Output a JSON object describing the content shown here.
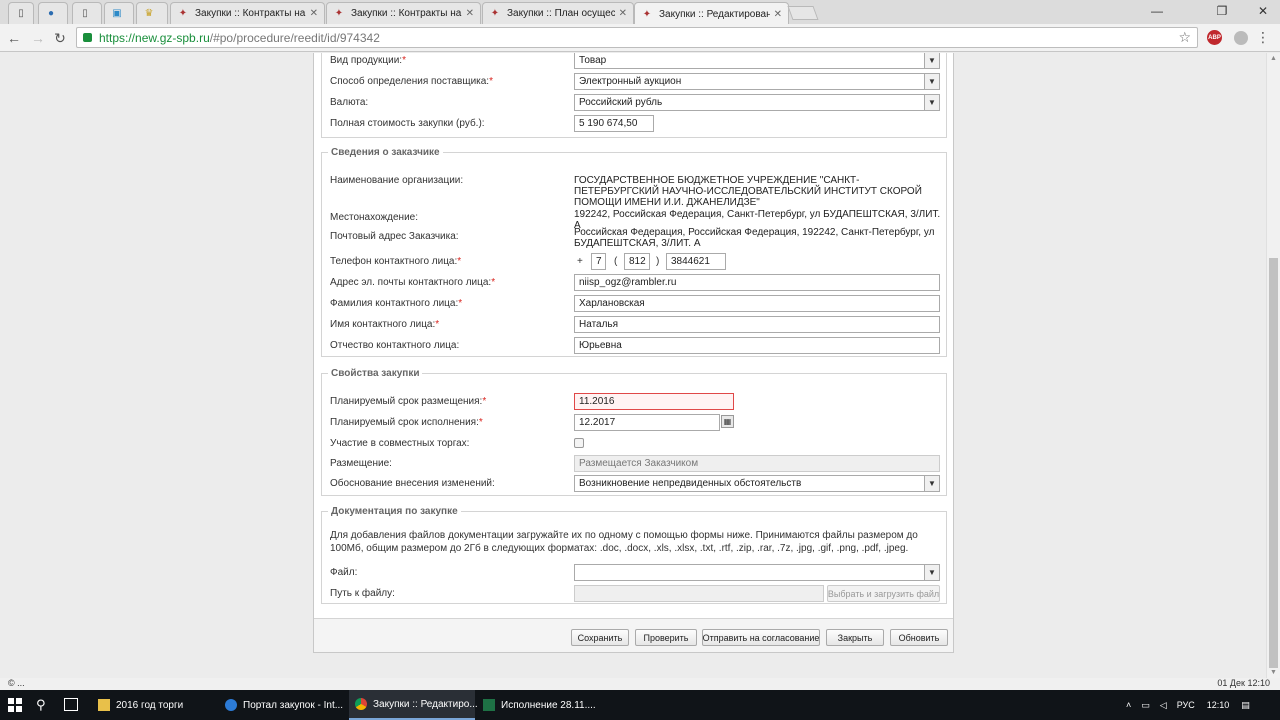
{
  "browser": {
    "tabs": [
      {
        "label": "",
        "active": false
      },
      {
        "label": "",
        "active": false
      },
      {
        "label": "",
        "active": false
      },
      {
        "label": "",
        "active": false
      },
      {
        "label": "",
        "active": false
      },
      {
        "label": "Закупки :: Контракты на",
        "active": false
      },
      {
        "label": "Закупки :: Контракты на",
        "active": false
      },
      {
        "label": "Закупки :: План осущест",
        "active": false
      },
      {
        "label": "Закупки :: Редактирован",
        "active": true
      }
    ],
    "url_scheme": "https://",
    "url_host": "new.gz-spb.ru",
    "url_path": "/#po/procedure/reedit/id/974342",
    "extension_abp": "ABP"
  },
  "form": {
    "top": {
      "product_type_label": "Вид продукции:",
      "product_type_value": "Товар",
      "supplier_method_label": "Способ определения поставщика:",
      "supplier_method_value": "Электронный аукцион",
      "currency_label": "Валюта:",
      "currency_value": "Российский рубль",
      "total_cost_label": "Полная стоимость закупки (руб.):",
      "total_cost_value": "5 190 674,50"
    },
    "customer": {
      "legend": "Сведения о заказчике",
      "org_name_label": "Наименование организации:",
      "org_name_value": "ГОСУДАРСТВЕННОЕ БЮДЖЕТНОЕ УЧРЕЖДЕНИЕ \"САНКТ-ПЕТЕРБУРГСКИЙ НАУЧНО-ИССЛЕДОВАТЕЛЬСКИЙ ИНСТИТУТ СКОРОЙ ПОМОЩИ ИМЕНИ И.И. ДЖАНЕЛИДЗЕ\"",
      "location_label": "Местонахождение:",
      "location_value": "192242, Российская Федерация, Санкт-Петербург, ул БУДАПЕШТСКАЯ, 3/ЛИТ. А",
      "postal_label": "Почтовый адрес Заказчика:",
      "postal_value": "Российская Федерация, Российская Федерация, 192242, Санкт-Петербург, ул БУДАПЕШТСКАЯ, 3/ЛИТ. А",
      "phone_label": "Телефон контактного лица:",
      "phone_plus": "+",
      "phone_country": "7",
      "phone_open": "(",
      "phone_code": "812",
      "phone_close": ")",
      "phone_number": "3844621",
      "email_label": "Адрес эл. почты контактного лица:",
      "email_value": "niisp_ogz@rambler.ru",
      "lastname_label": "Фамилия контактного лица:",
      "lastname_value": "Харлановская",
      "firstname_label": "Имя контактного лица:",
      "firstname_value": "Наталья",
      "patronymic_label": "Отчество контактного лица:",
      "patronymic_value": "Юрьевна"
    },
    "properties": {
      "legend": "Свойства закупки",
      "placement_date_label": "Планируемый срок размещения:",
      "placement_date_value": "11.2016",
      "execution_date_label": "Планируемый срок исполнения:",
      "execution_date_value": "12.2017",
      "joint_label": "Участие в совместных торгах:",
      "placement_label": "Размещение:",
      "placement_value": "Размещается Заказчиком",
      "reason_label": "Обоснование внесения изменений:",
      "reason_value": "Возникновение непредвиденных обстоятельств"
    },
    "documents": {
      "legend": "Документация по закупке",
      "info": "Для добавления файлов документации загружайте их по одному с помощью формы ниже. Принимаются файлы размером до 100Мб, общим размером до 2Гб в следующих форматах: .doc, .docx, .xls, .xlsx, .txt, .rtf, .zip, .rar, .7z, .jpg, .gif, .png, .pdf, .jpeg.",
      "file_label": "Файл:",
      "path_label": "Путь к файлу:",
      "upload_button": "Выбрать и загрузить файл"
    },
    "buttons": {
      "save": "Сохранить",
      "check": "Проверить",
      "send_approval": "Отправить на согласование",
      "close": "Закрыть",
      "refresh": "Обновить"
    }
  },
  "statusbar": {
    "left": "© ...",
    "right": "01 Дек 12:10"
  },
  "taskbar": {
    "items": [
      {
        "label": "2016 год торги",
        "active": false
      },
      {
        "label": "Портал закупок - Int...",
        "active": false
      },
      {
        "label": "Закупки :: Редактиро...",
        "active": true
      },
      {
        "label": "Исполнение 28.11....",
        "active": false
      }
    ],
    "lang": "РУС",
    "time": "12:10"
  },
  "colors": {
    "required": "#d9231d",
    "error_border": "#e04848",
    "secure_green": "#1a8f3c"
  }
}
